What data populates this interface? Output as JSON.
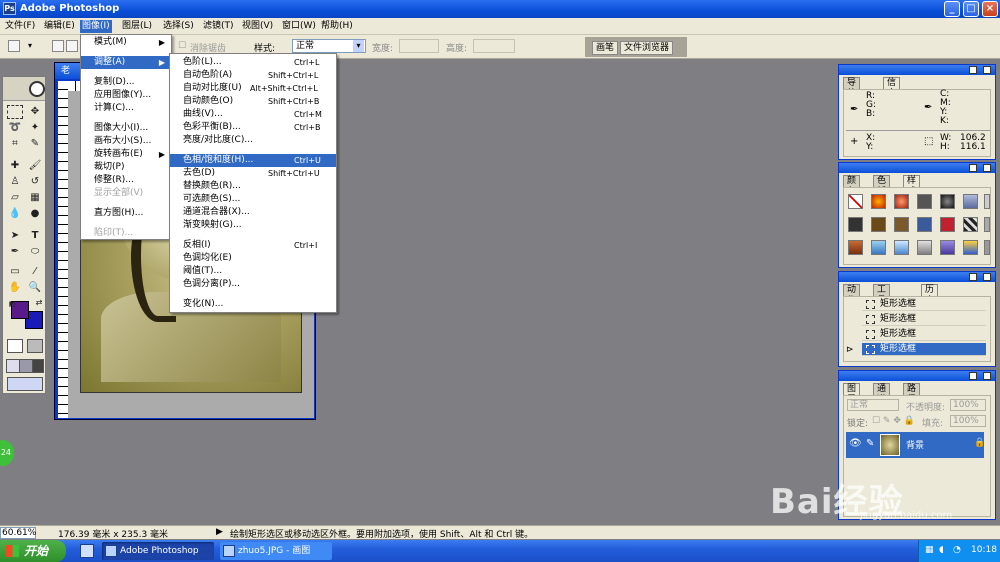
{
  "window": {
    "title": "Adobe Photoshop",
    "icon": "photoshop-icon"
  },
  "menubar": {
    "items": [
      {
        "label": "文件(F)"
      },
      {
        "label": "编辑(E)"
      },
      {
        "label": "图像(I)"
      },
      {
        "label": "图层(L)"
      },
      {
        "label": "选择(S)"
      },
      {
        "label": "滤镜(T)"
      },
      {
        "label": "视图(V)"
      },
      {
        "label": "窗口(W)"
      },
      {
        "label": "帮助(H)"
      }
    ],
    "active": "图像(I)"
  },
  "options": {
    "antialias_label": "消除锯齿",
    "style_label": "样式:",
    "style_value": "正常",
    "width_label": "宽度:",
    "height_label": "高度:",
    "palette_tabs": [
      "画笔",
      "文件浏览器"
    ]
  },
  "image_menu": {
    "items": [
      {
        "label": "模式(M)",
        "submenu": true
      },
      {
        "label": "调整(A)",
        "submenu": true,
        "selected": true
      },
      {
        "label": "复制(D)..."
      },
      {
        "label": "应用图像(Y)..."
      },
      {
        "label": "计算(C)..."
      },
      {
        "label": "图像大小(I)..."
      },
      {
        "label": "画布大小(S)..."
      },
      {
        "label": "旋转画布(E)",
        "submenu": true
      },
      {
        "label": "裁切(P)"
      },
      {
        "label": "修整(R)..."
      },
      {
        "label": "显示全部(V)",
        "disabled": true
      },
      {
        "label": "直方图(H)..."
      },
      {
        "label": "陷印(T)...",
        "disabled": true
      }
    ]
  },
  "adjust_menu": {
    "items": [
      {
        "label": "色阶(L)...",
        "shortcut": "Ctrl+L"
      },
      {
        "label": "自动色阶(A)",
        "shortcut": "Shift+Ctrl+L"
      },
      {
        "label": "自动对比度(U)",
        "shortcut": "Alt+Shift+Ctrl+L"
      },
      {
        "label": "自动颜色(O)",
        "shortcut": "Shift+Ctrl+B"
      },
      {
        "label": "曲线(V)...",
        "shortcut": "Ctrl+M"
      },
      {
        "label": "色彩平衡(B)...",
        "shortcut": "Ctrl+B"
      },
      {
        "label": "亮度/对比度(C)...",
        "shortcut": ""
      },
      {
        "label": "色相/饱和度(H)...",
        "shortcut": "Ctrl+U",
        "selected": true
      },
      {
        "label": "去色(D)",
        "shortcut": "Shift+Ctrl+U"
      },
      {
        "label": "替换颜色(R)...",
        "shortcut": ""
      },
      {
        "label": "可选颜色(S)...",
        "shortcut": ""
      },
      {
        "label": "通道混合器(X)...",
        "shortcut": ""
      },
      {
        "label": "渐变映射(G)...",
        "shortcut": ""
      },
      {
        "label": "反相(I)",
        "shortcut": "Ctrl+I"
      },
      {
        "label": "色调均化(E)",
        "shortcut": ""
      },
      {
        "label": "阈值(T)...",
        "shortcut": ""
      },
      {
        "label": "色调分离(P)...",
        "shortcut": ""
      },
      {
        "label": "变化(N)...",
        "shortcut": ""
      }
    ]
  },
  "document": {
    "title": "老"
  },
  "navigator_panel": {
    "tabs": [
      "导航器",
      "信息"
    ],
    "active_tab": "信息",
    "rgb_labels": [
      "R:",
      "G:",
      "B:"
    ],
    "cmyk_labels": [
      "C:",
      "M:",
      "Y:",
      "K:"
    ],
    "x_label": "X:",
    "y_label": "Y:",
    "w_label": "W:",
    "h_label": "H:",
    "w_value": "106.2",
    "h_value": "116.1"
  },
  "color_panel": {
    "tabs": [
      "颜色",
      "色板",
      "样式"
    ],
    "active_tab": "样式"
  },
  "history_panel": {
    "tabs": [
      "动作",
      "工具预设",
      "历史记录"
    ],
    "active_tab": "历史记录",
    "rows": [
      {
        "label": "矩形选框"
      },
      {
        "label": "矩形选框"
      },
      {
        "label": "矩形选框"
      },
      {
        "label": "矩形选框",
        "selected": true
      }
    ]
  },
  "layers_panel": {
    "tabs": [
      "图层",
      "通道",
      "路径"
    ],
    "active_tab": "图层",
    "blend_mode": "正常",
    "opacity_label": "不透明度:",
    "opacity_value": "100%",
    "lock_label": "锁定:",
    "fill_label": "填充:",
    "fill_value": "100%",
    "layer_name": "背景"
  },
  "statusbar": {
    "zoom": "60.61%",
    "doc_size": "176.39 毫米 x 235.3 毫米",
    "hint": "绘制矩形选区或移动选区外框。要用附加选项，使用 Shift、Alt 和 Ctrl 键。"
  },
  "taskbar": {
    "start_label": "开始",
    "tasks": [
      {
        "label": "Adobe Photoshop"
      },
      {
        "label": "zhuo5.JPG - 画图"
      }
    ],
    "clock": "10:18"
  },
  "watermark": {
    "text": "Bai经验",
    "url": "jingyan.baidu.com"
  },
  "badge": {
    "text": "24"
  },
  "colors": {
    "foreground": "#5a1a8a",
    "background": "#1a1ab8",
    "accent": "#316ac5"
  }
}
